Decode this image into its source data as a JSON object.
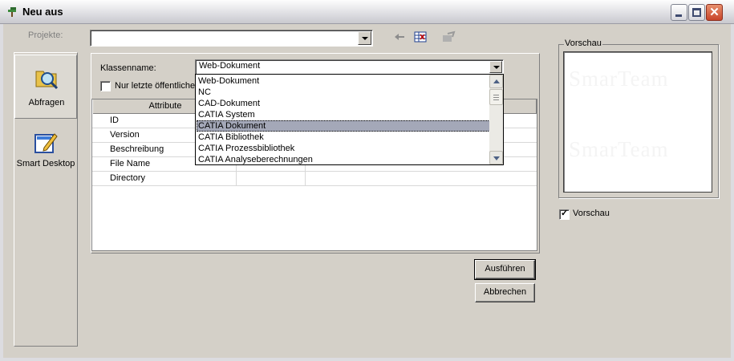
{
  "window": {
    "title": "Neu aus",
    "min_label": "_",
    "max_label": "□",
    "close_label": "✕"
  },
  "projekte": {
    "label": "Projekte:",
    "value": ""
  },
  "nav": {
    "items": [
      {
        "label": "Abfragen",
        "icon": "magnifier-folder-icon",
        "active": true
      },
      {
        "label": "Smart Desktop",
        "icon": "desktop-edit-icon",
        "active": false
      }
    ]
  },
  "klassenname": {
    "label": "Klassenname:",
    "value": "Web-Dokument"
  },
  "nur_letzte": {
    "label": "Nur letzte öffentliche",
    "checked": false
  },
  "grid": {
    "columns": [
      "Attribute",
      "",
      ""
    ],
    "rows": [
      "ID",
      "Version",
      "Beschreibung",
      "File Name",
      "Directory"
    ]
  },
  "dropdown": {
    "options": [
      "Web-Dokument",
      "NC",
      "CAD-Dokument",
      "CATIA System",
      "CATIA Dokument",
      "CATIA Bibliothek",
      "CATIA Prozessbibliothek",
      "CATIA Analyseberechnungen"
    ],
    "selected_index": 4
  },
  "buttons": {
    "execute_label": "Ausführen",
    "cancel_label": "Abbrechen"
  },
  "preview": {
    "group_title": "Vorschau",
    "watermark": "SmarTeam",
    "checkbox_label": "Vorschau",
    "checked": true
  },
  "colors": {
    "dialog_bg": "#d4d0c8",
    "selection": "#a4a8b8",
    "close_button": "#c8442a"
  }
}
